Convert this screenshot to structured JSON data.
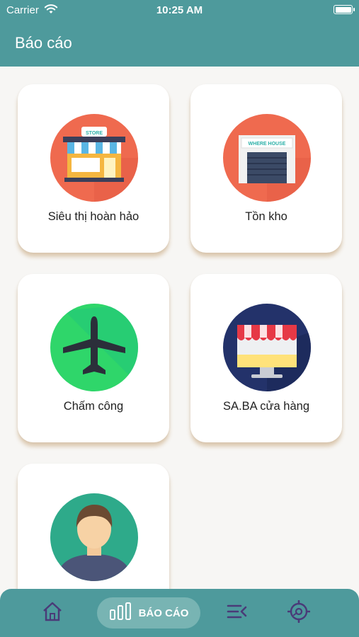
{
  "status_bar": {
    "carrier": "Carrier",
    "time": "10:25 AM"
  },
  "header": {
    "title": "Báo cáo"
  },
  "cards": [
    {
      "label": "Siêu thị hoàn hảo",
      "icon": "store-icon",
      "sign": "STORE"
    },
    {
      "label": "Tồn kho",
      "icon": "warehouse-icon",
      "sign": "WHERE HOUSE"
    },
    {
      "label": "Chấm công",
      "icon": "airplane-icon"
    },
    {
      "label": "SA.BA cửa hàng",
      "icon": "shop-screen-icon"
    },
    {
      "label": "",
      "icon": "user-avatar-icon"
    }
  ],
  "tab_bar": {
    "items": [
      {
        "name": "home",
        "icon": "home-icon"
      },
      {
        "name": "report",
        "icon": "bar-chart-icon",
        "label": "BÁO CÁO",
        "active": true
      },
      {
        "name": "menu",
        "icon": "menu-list-icon"
      },
      {
        "name": "settings",
        "icon": "gear-icon"
      }
    ]
  },
  "colors": {
    "primary": "#4e9a9c",
    "active_tab": "#78b4b3",
    "tab_icon": "#4a3a78",
    "background": "#f7f6f4"
  }
}
